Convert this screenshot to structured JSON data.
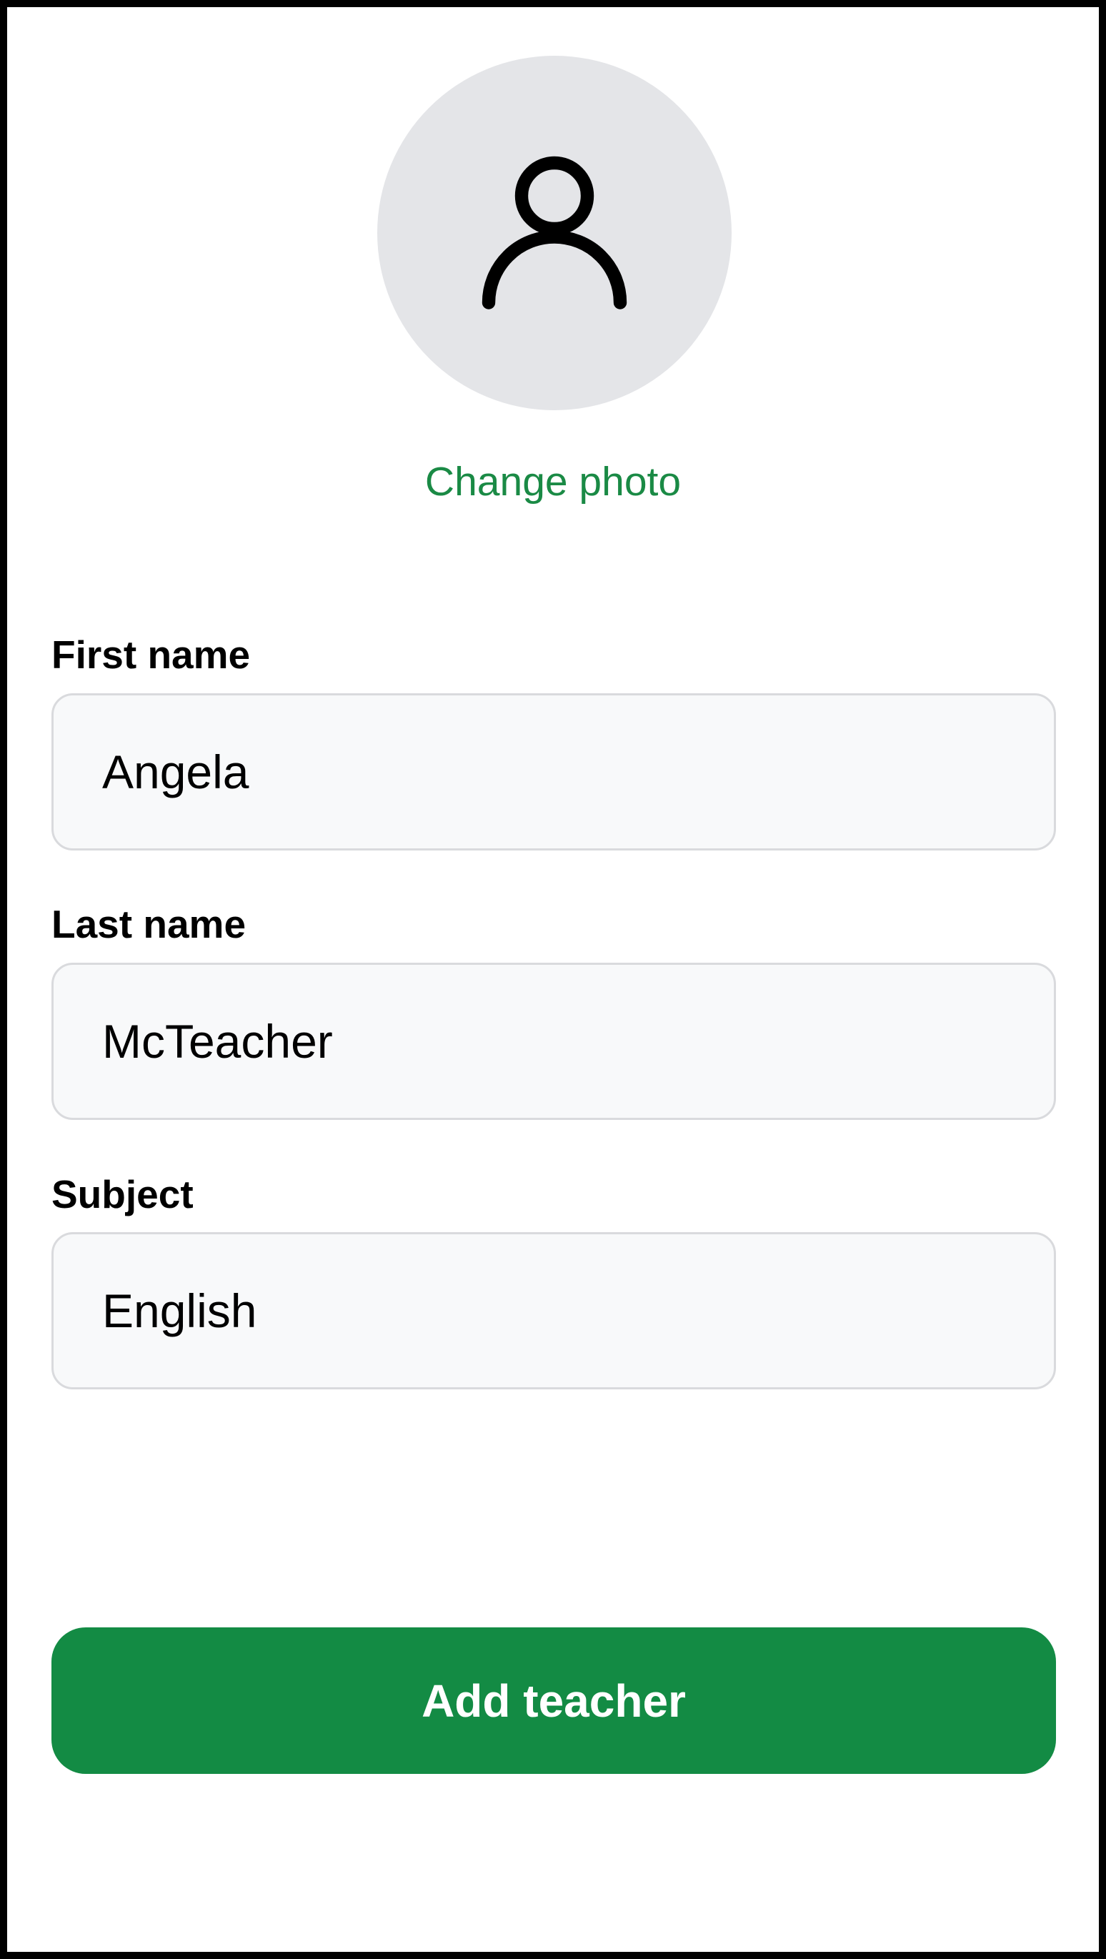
{
  "profile": {
    "avatar_icon": "user-icon",
    "change_photo_label": "Change photo"
  },
  "form": {
    "first_name": {
      "label": "First name",
      "value": "Angela"
    },
    "last_name": {
      "label": "Last name",
      "value": "McTeacher"
    },
    "subject": {
      "label": "Subject",
      "value": "English"
    }
  },
  "actions": {
    "add_teacher_label": "Add teacher"
  },
  "colors": {
    "accent_green": "#138b44",
    "link_green": "#1a8a45",
    "avatar_bg": "#e4e5e8",
    "input_bg": "#f8f9fa",
    "input_border": "#d9dadd"
  }
}
